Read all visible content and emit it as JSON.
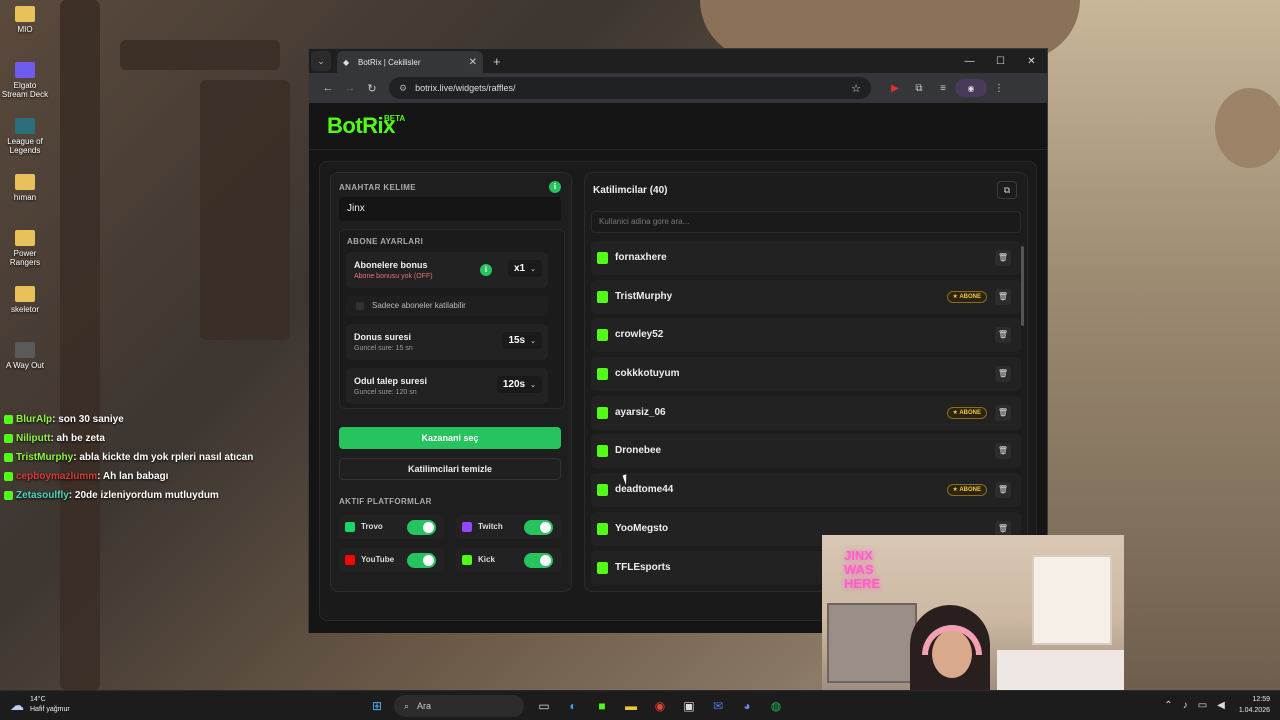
{
  "desktop": {
    "icons": [
      {
        "label": "MIO",
        "color": "#e8c15a"
      },
      {
        "label": "Elgato Stream Deck",
        "color": "#6e5cf0"
      },
      {
        "label": "League of Legends",
        "color": "#2c6e7a"
      },
      {
        "label": "hıman",
        "color": "#e8c15a"
      },
      {
        "label": "Power Rangers",
        "color": "#e8c15a"
      },
      {
        "label": "skeletor",
        "color": "#e8c15a"
      },
      {
        "label": "A Way Out",
        "color": "#5a5a5a"
      }
    ]
  },
  "chat": [
    {
      "name": "BlurAlp",
      "message": ": son 30 saniye"
    },
    {
      "name": "Niliputt",
      "message": ": ah be zeta"
    },
    {
      "name": "TristMurphy",
      "message": ": abla kickte dm yok rpleri nasıl atıcan"
    },
    {
      "name": "cepboymazlumm",
      "message": ": Ah lan babagı"
    },
    {
      "name": "Zetasoulfly",
      "message": ": 20de izleniyordum mutluydum"
    }
  ],
  "browser": {
    "tab_title": "BotRix | Cekilisler",
    "url": "botrix.live/widgets/raffles/"
  },
  "app": {
    "logo": "BotRix",
    "beta": "BETA",
    "keyword": {
      "title": "ANAHTAR KELIME",
      "value": "Jinx",
      "info": "i"
    },
    "subscriber": {
      "title": "ABONE AYARLARI",
      "bonus_label": "Abonelere bonus",
      "bonus_sub": "Abone bonusu yok (OFF)",
      "bonus_value": "x1",
      "only_subs": "Sadece aboneler katilabilir",
      "spin_label": "Donus suresi",
      "spin_sub": "Guncel sure: 15 sn",
      "spin_value": "15s",
      "claim_label": "Odul talep suresi",
      "claim_sub": "Guncel sure: 120 sn",
      "claim_value": "120s"
    },
    "pick_winner": "Kazanani seç",
    "clear_participants": "Katilimcilari temizle",
    "platforms": {
      "title": "AKTIF PLATFORMLAR",
      "items": [
        {
          "name": "Trovo",
          "color": "#19d66b",
          "enabled": true
        },
        {
          "name": "Twitch",
          "color": "#9146ff",
          "enabled": true
        },
        {
          "name": "YouTube",
          "color": "#ff0000",
          "enabled": true
        },
        {
          "name": "Kick",
          "color": "#53fc18",
          "enabled": true
        }
      ]
    },
    "participants": {
      "title": "Katilimcilar (40)",
      "search_placeholder": "Kullanici adina gore ara...",
      "badge_label": "ABONE",
      "list": [
        {
          "name": "fornaxhere",
          "subscriber": false
        },
        {
          "name": "TristMurphy",
          "subscriber": true
        },
        {
          "name": "crowley52",
          "subscriber": false
        },
        {
          "name": "cokkkotuyum",
          "subscriber": false
        },
        {
          "name": "ayarsiz_06",
          "subscriber": true
        },
        {
          "name": "Dronebee",
          "subscriber": false
        },
        {
          "name": "deadtome44",
          "subscriber": true
        },
        {
          "name": "YooMegsto",
          "subscriber": false
        },
        {
          "name": "TFLEsports",
          "subscriber": false
        }
      ]
    }
  },
  "webcam": {
    "neon_sign": "JINX WAS HERE"
  },
  "taskbar": {
    "temperature": "14°C",
    "weather": "Hafif yağmur",
    "search": "Ara",
    "time": "12:59",
    "date": "1.04.2026"
  },
  "colors": {
    "accent_green": "#53fc18",
    "button_green": "#27c35f",
    "badge_gold": "#f4c542"
  }
}
